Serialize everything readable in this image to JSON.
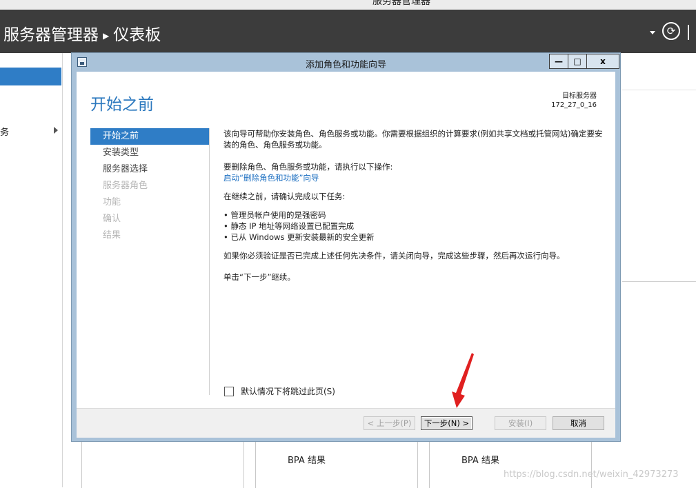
{
  "os_title": "服务器管理器",
  "header": {
    "title": "服务器管理器",
    "separator": "▶",
    "subtitle": "仪表板",
    "refresh_glyph": "⟳"
  },
  "sidebar": {
    "partial_item": "务"
  },
  "tiles": [
    {
      "label": "BPA 结果"
    },
    {
      "label": "BPA 结果"
    }
  ],
  "watermark": "https://blog.csdn.net/weixin_42973273",
  "wizard": {
    "title": "添加角色和功能向导",
    "controls": {
      "minimize": "—",
      "maximize": "□",
      "close": "x"
    },
    "heading": "开始之前",
    "target_label": "目标服务器",
    "target_value": "172_27_0_16",
    "nav": [
      {
        "label": "开始之前",
        "state": "active"
      },
      {
        "label": "安装类型",
        "state": "enabled"
      },
      {
        "label": "服务器选择",
        "state": "enabled"
      },
      {
        "label": "服务器角色",
        "state": "disabled"
      },
      {
        "label": "功能",
        "state": "disabled"
      },
      {
        "label": "确认",
        "state": "disabled"
      },
      {
        "label": "结果",
        "state": "disabled"
      }
    ],
    "content": {
      "intro": "该向导可帮助你安装角色、角色服务或功能。你需要根据组织的计算要求(例如共享文档或托管网站)确定要安装的角色、角色服务或功能。",
      "remove_prompt": "要删除角色、角色服务或功能，请执行以下操作:",
      "remove_link": "启动“删除角色和功能”向导",
      "before_continue": "在继续之前，请确认完成以下任务:",
      "bullets": [
        "管理员帐户使用的是强密码",
        "静态 IP 地址等网络设置已配置完成",
        "已从 Windows 更新安装最新的安全更新"
      ],
      "verify_note": "如果你必须验证是否已完成上述任何先决条件，请关闭向导，完成这些步骤，然后再次运行向导。",
      "click_next": "单击“下一步”继续。"
    },
    "skip_checkbox": {
      "label": "默认情况下将跳过此页(S)",
      "checked": false
    },
    "buttons": {
      "prev": "< 上一步(P)",
      "next": "下一步(N) >",
      "install": "安装(I)",
      "cancel": "取消"
    }
  },
  "colors": {
    "accent": "#2f7dc6",
    "header_bg": "#3c3c3c",
    "wizard_frame": "#a9c2d9",
    "arrow": "#e02020"
  }
}
